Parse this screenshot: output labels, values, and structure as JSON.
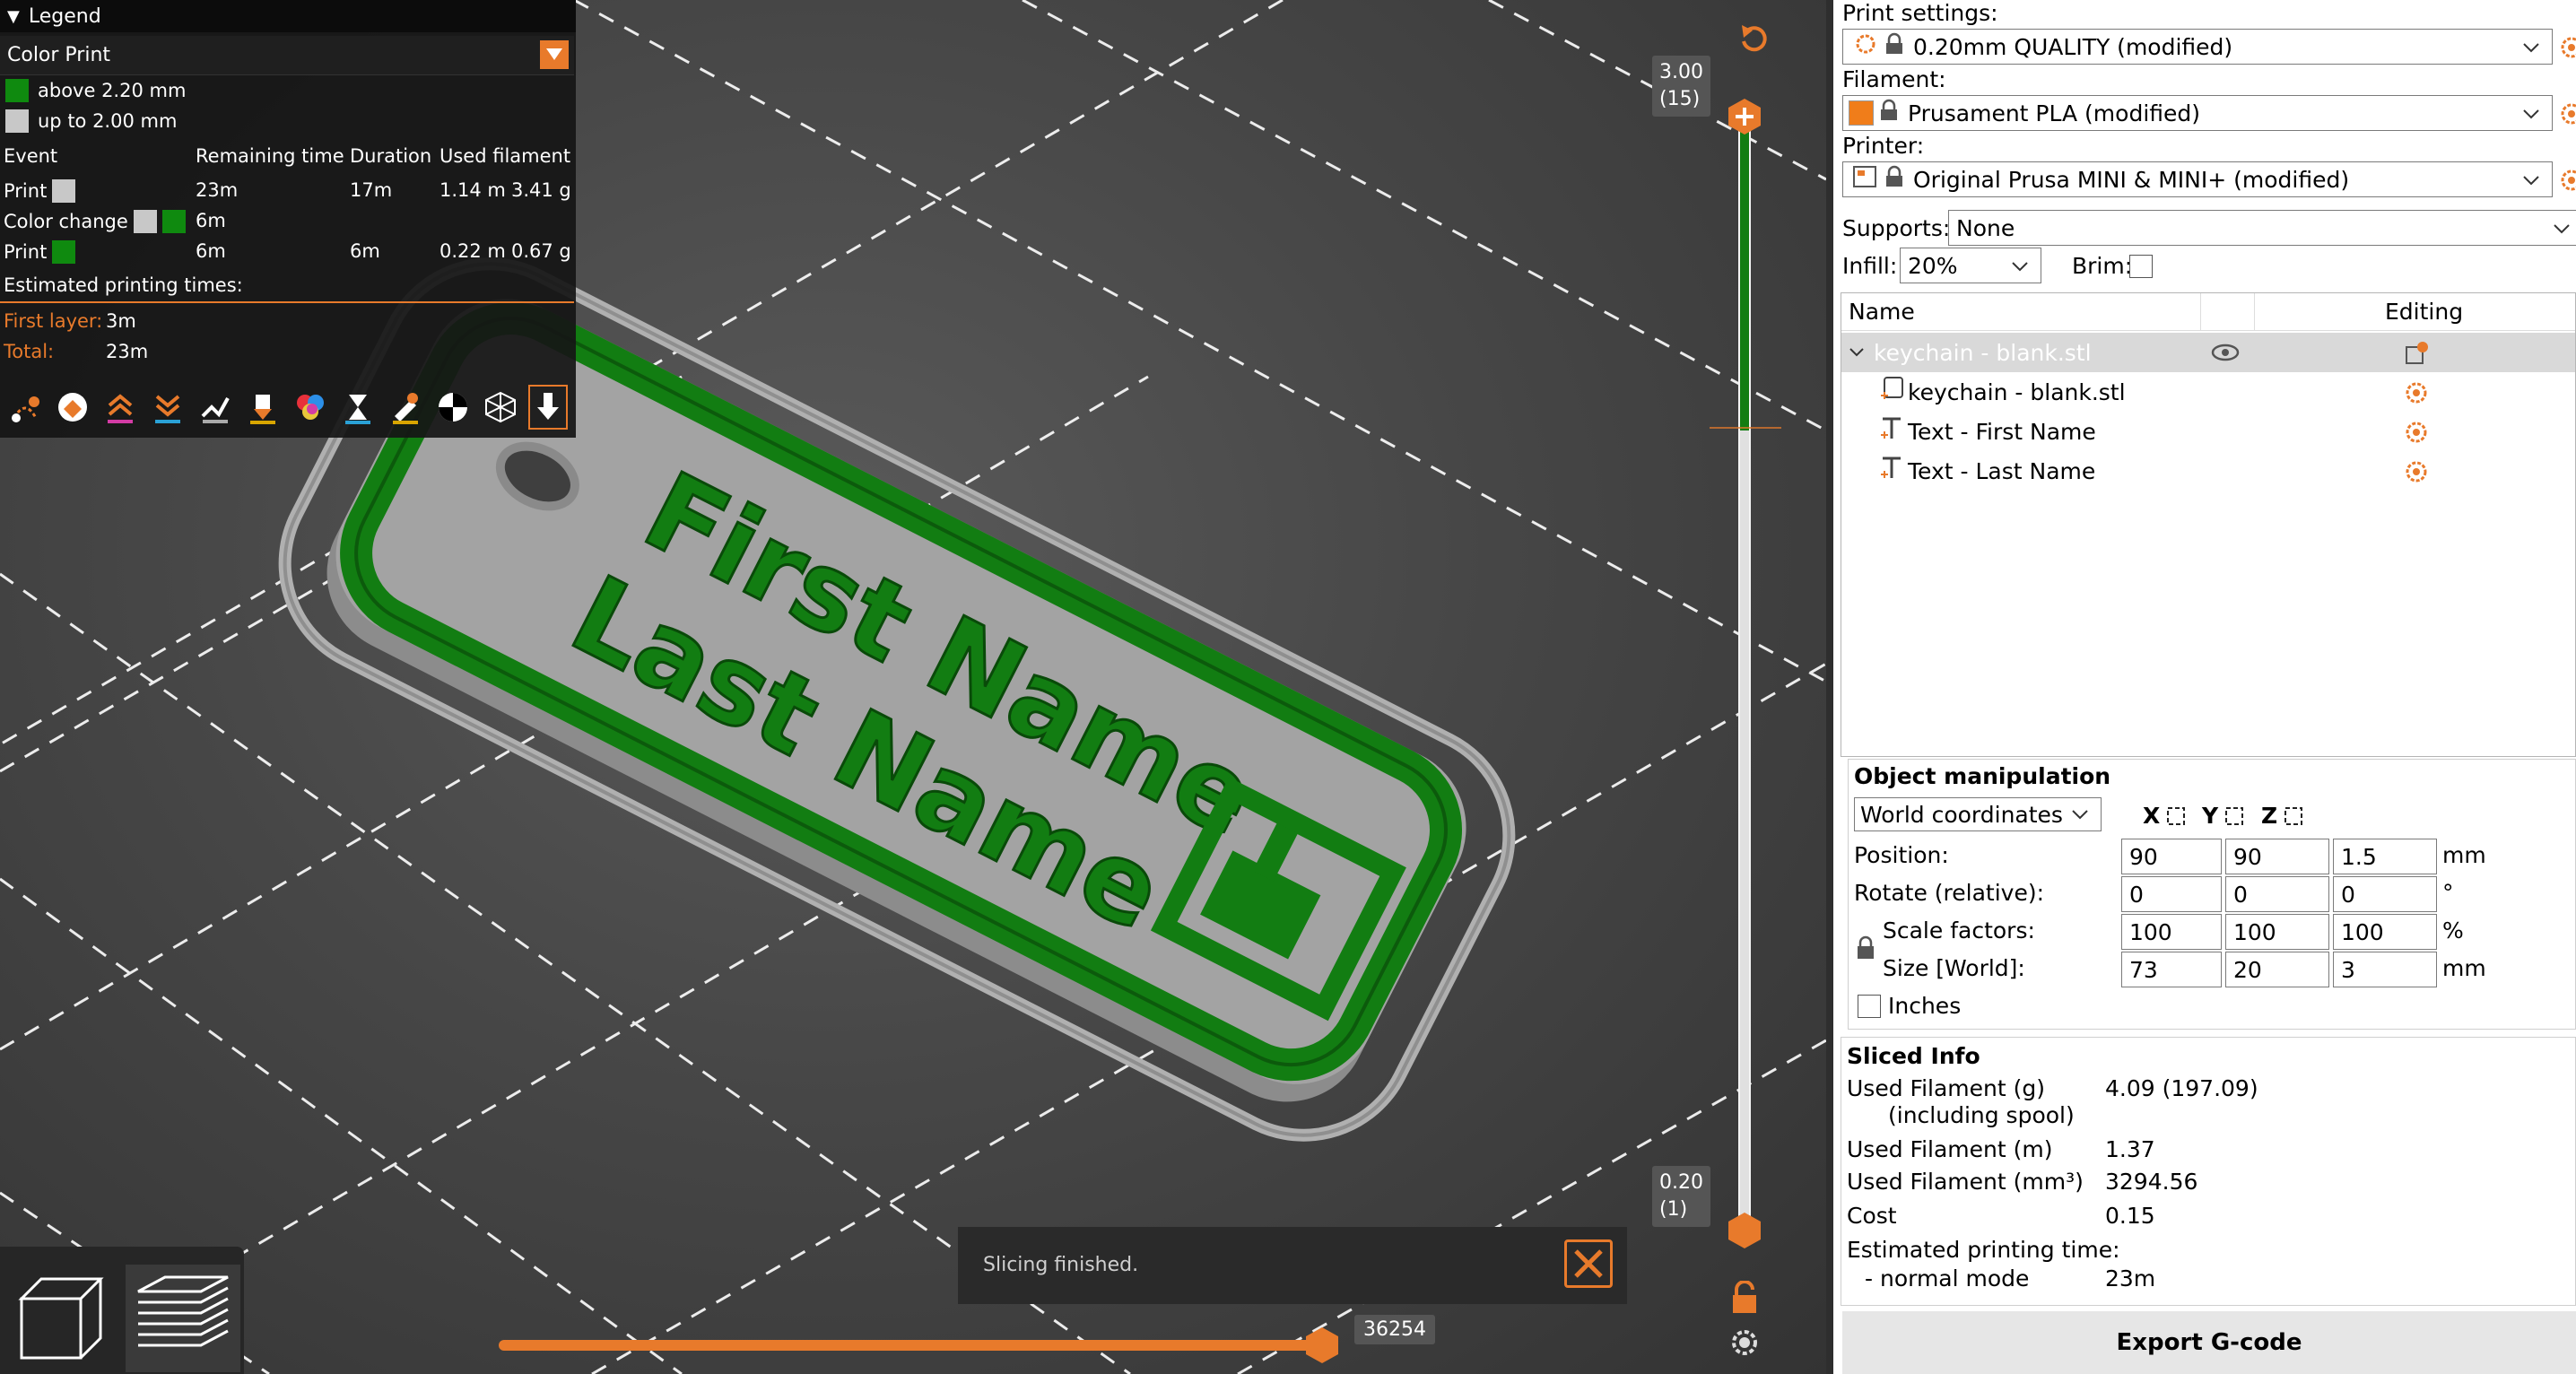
{
  "legend": {
    "title": "Legend",
    "view_type": "Color Print",
    "color_ranges": [
      {
        "label": "above 2.20 mm",
        "color": "#0f8a0f"
      },
      {
        "label": "up to 2.00 mm",
        "color": "#c8c8c8"
      }
    ],
    "columns": [
      "Event",
      "Remaining time",
      "Duration",
      "Used filament"
    ],
    "events": [
      {
        "event": "Print",
        "remaining": "23m",
        "duration": "17m",
        "length": "1.14 m",
        "weight": "3.41 g"
      },
      {
        "event": "Color change",
        "remaining": "6m",
        "duration": "",
        "length": "",
        "weight": ""
      },
      {
        "event": "Print",
        "remaining": "6m",
        "duration": "6m",
        "length": "0.22 m",
        "weight": "0.67 g"
      }
    ],
    "estimated_label": "Estimated printing times:",
    "first_layer_label": "First layer:",
    "first_layer_value": "3m",
    "total_label": "Total:",
    "total_value": "23m",
    "icons": [
      "travel-icon",
      "wipe-icon",
      "retractions-icon",
      "deretractions-icon",
      "seams-icon",
      "tool-changes-icon",
      "color-changes-icon",
      "pause-icon",
      "custom-gcode-icon",
      "center-of-gravity-icon",
      "shells-icon",
      "tool-marker-icon"
    ]
  },
  "model": {
    "line1": "First Name",
    "line2": "Last Name",
    "green": "#127d12",
    "gray": "#a8a8a8"
  },
  "vertical_slider": {
    "top_value": "3.00",
    "top_layer": "(15)",
    "bottom_value": "0.20",
    "bottom_layer": "(1)",
    "accent": "#e87a2b"
  },
  "horizontal_slider": {
    "value": "36254"
  },
  "notification": {
    "text": "Slicing finished."
  },
  "sidebar": {
    "print_settings_label": "Print settings:",
    "print_settings_value": "0.20mm QUALITY (modified)",
    "filament_label": "Filament:",
    "filament_value": "Prusament PLA (modified)",
    "filament_color": "#f07d1a",
    "printer_label": "Printer:",
    "printer_value": "Original Prusa MINI & MINI+ (modified)",
    "supports_label": "Supports:",
    "supports_value": "None",
    "infill_label": "Infill:",
    "infill_value": "20%",
    "brim_label": "Brim:",
    "list_header_name": "Name",
    "list_header_editing": "Editing",
    "objects": [
      {
        "name": "keychain - blank.stl",
        "level": 0
      },
      {
        "name": "keychain - blank.stl",
        "level": 1
      },
      {
        "name": "Text - First Name",
        "level": 1
      },
      {
        "name": "Text - Last Name",
        "level": 1
      }
    ],
    "manip_title": "Object manipulation",
    "coord_mode": "World coordinates",
    "axes": [
      "X",
      "Y",
      "Z"
    ],
    "rows": [
      {
        "label": "Position:",
        "values": [
          "90",
          "90",
          "1.5"
        ],
        "unit": "mm"
      },
      {
        "label": "Rotate (relative):",
        "values": [
          "0",
          "0",
          "0"
        ],
        "unit": "°"
      },
      {
        "label": "Scale factors:",
        "values": [
          "100",
          "100",
          "100"
        ],
        "unit": "%"
      },
      {
        "label": "Size [World]:",
        "values": [
          "73",
          "20",
          "3"
        ],
        "unit": "mm"
      }
    ],
    "inches_label": "Inches",
    "sliced_title": "Sliced Info",
    "sliced": [
      {
        "label": "Used Filament (g)",
        "value": "4.09 (197.09)"
      },
      {
        "label": "(including spool)",
        "value": ""
      },
      {
        "label": "Used Filament (m)",
        "value": "1.37"
      },
      {
        "label": "Used Filament (mm³)",
        "value": "3294.56"
      },
      {
        "label": "Cost",
        "value": "0.15"
      },
      {
        "label": "Estimated printing time:",
        "value": ""
      },
      {
        "label": "- normal mode",
        "value": "23m"
      }
    ],
    "export_label": "Export G-code"
  }
}
